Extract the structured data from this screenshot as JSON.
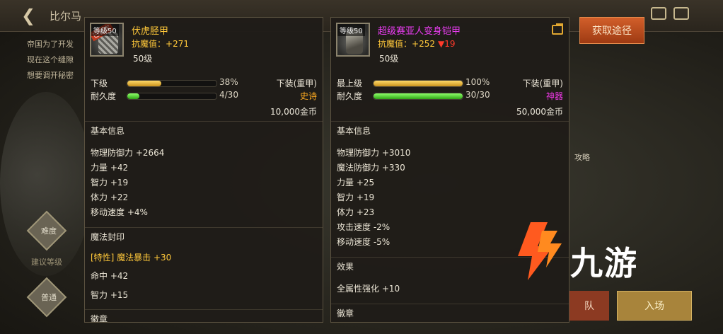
{
  "background": {
    "title": "比尔马克帝国试验场",
    "desc_lines": [
      "帝国为了开发",
      "现在这个缝隙",
      "想要调开秘密"
    ],
    "diamond_label": "难度",
    "small_label": "建议等级",
    "diamond_bottom_label": "普通",
    "right_partial_text": "攻略",
    "btn_left": "队",
    "btn_right": "入场"
  },
  "obtain_button": "获取途径",
  "left_item": {
    "name": "伏虎胫甲",
    "level_tag": "等级50",
    "locked_badge": "已锁定",
    "resist_label": "抗魔值：",
    "resist_value": "+271",
    "req_level": "50级",
    "grade_label": "下级",
    "grade_pct": "38%",
    "grade_value": 0.38,
    "slot": "下装(重甲)",
    "durability_label": "耐久度",
    "durability_text": "4/30",
    "durability_value": 0.1333,
    "rarity": "史诗",
    "price": "10,000金币",
    "section_basic": "基本信息",
    "basic_stats": [
      "物理防御力 +2664",
      "力量 +42",
      "智力 +19",
      "体力 +22",
      "移动速度 +4%"
    ],
    "section_seal": "魔法封印",
    "seal_lines": [
      {
        "text": "[特性] 魔法暴击 +30",
        "style": "gold"
      },
      {
        "text": "命中 +42",
        "style": "normal"
      },
      {
        "text": "智力 +15",
        "style": "normal"
      }
    ],
    "section_next": "徽章"
  },
  "right_item": {
    "name": "超级赛亚人变身铠甲",
    "level_tag": "等级50",
    "resist_label": "抗魔值：",
    "resist_value": "+252",
    "resist_diff": "▼19",
    "req_level": "50级",
    "grade_label": "最上级",
    "grade_pct": "100%",
    "grade_value": 1.0,
    "slot": "下装(重甲)",
    "durability_label": "耐久度",
    "durability_text": "30/30",
    "durability_value": 1.0,
    "rarity": "神器",
    "price": "50,000金币",
    "section_basic": "基本信息",
    "basic_stats": [
      "物理防御力 +3010",
      "魔法防御力 +330",
      "力量 +25",
      "智力 +19",
      "体力 +23",
      "攻击速度 -2%",
      "移动速度 -5%"
    ],
    "section_effect": "效果",
    "effect_lines": [
      "全属性强化 +10"
    ],
    "section_badge": "徽章"
  },
  "watermark": {
    "text": "九游",
    "icon": "jiuyou-logo-icon"
  },
  "colors": {
    "gold": "#ffc83a",
    "purple": "#e83cf0",
    "epic": "#ffab20",
    "artifact": "#ee38e6",
    "down": "#ff3a2a"
  }
}
